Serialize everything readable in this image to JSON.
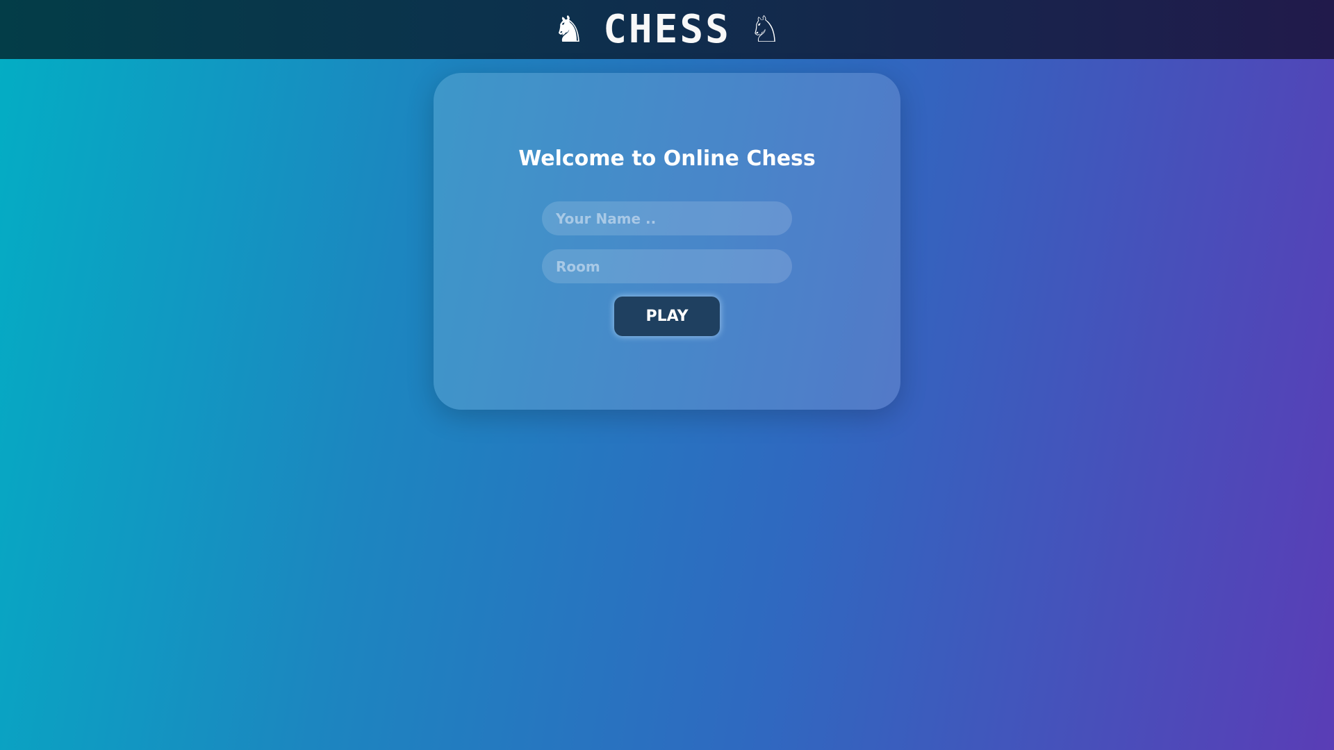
{
  "header": {
    "title": "CHESS",
    "left_icon": "black-knight",
    "right_icon": "white-knight",
    "left_glyph": "♞",
    "right_glyph": "♘"
  },
  "card": {
    "title": "Welcome to Online Chess",
    "name_placeholder": "Your Name ..",
    "room_placeholder": "Room",
    "play_label": "PLAY"
  }
}
